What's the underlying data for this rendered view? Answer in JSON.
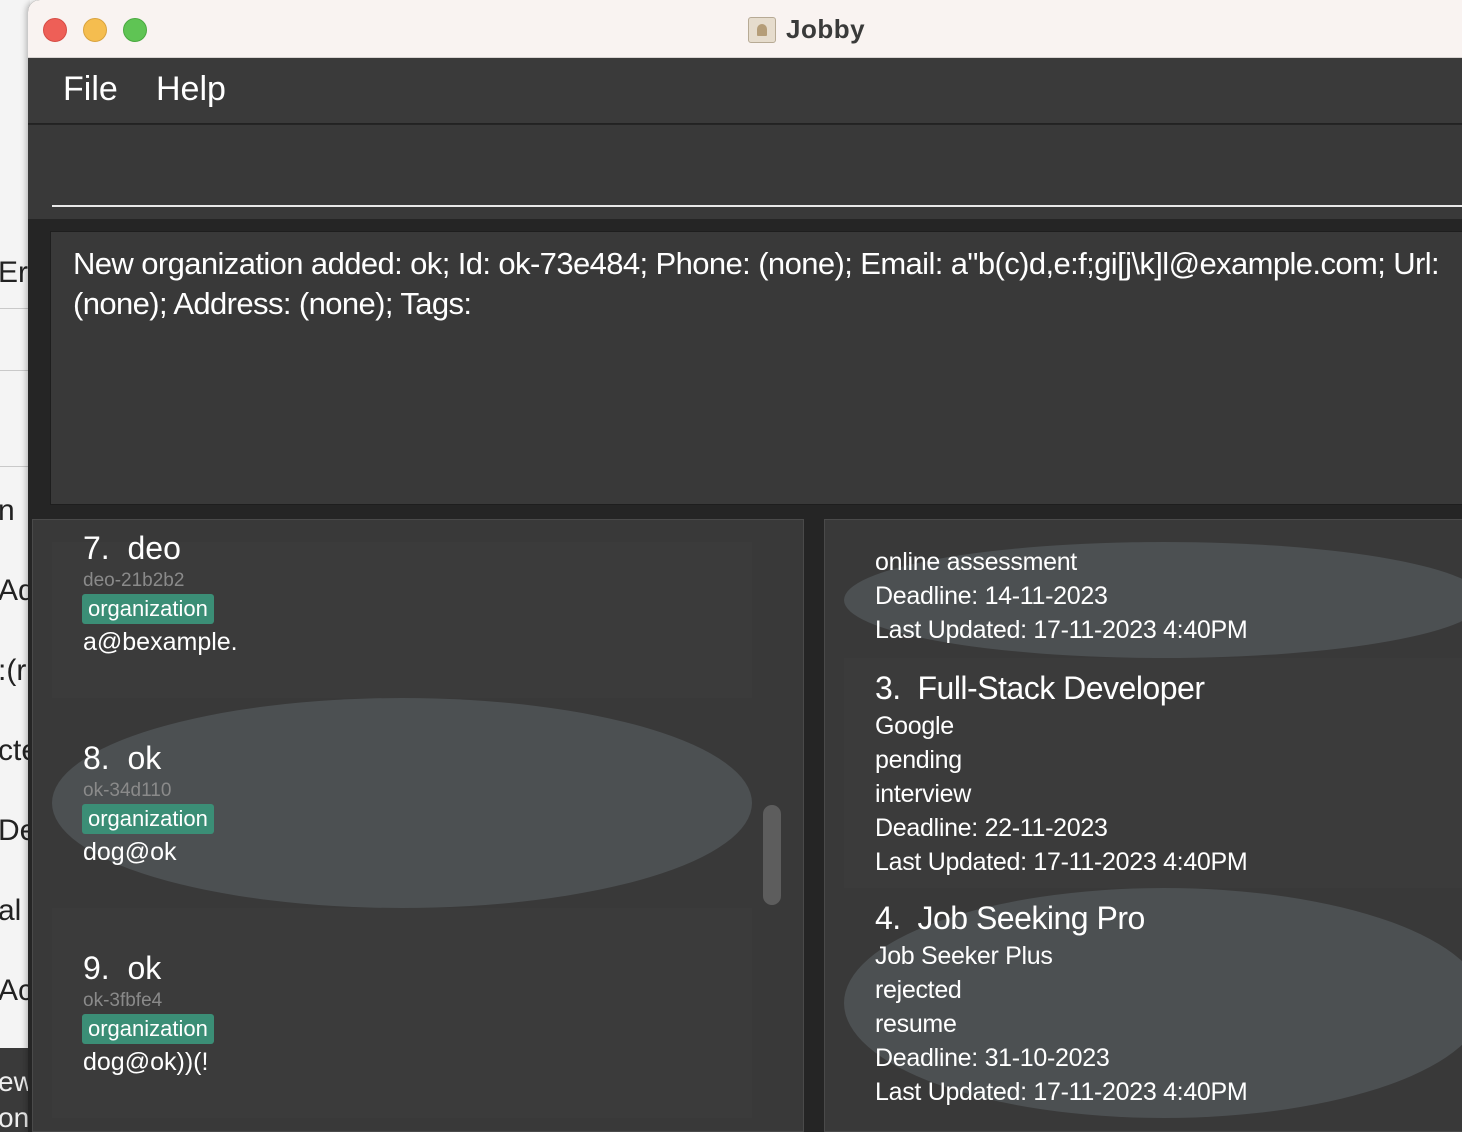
{
  "background_window": {
    "fragments": [
      "Er",
      "n",
      "Ad",
      ":(r",
      "cte",
      "De",
      "al E",
      "Acc",
      "ew",
      "one"
    ]
  },
  "window": {
    "title": "Jobby",
    "menu": [
      "File",
      "Help"
    ]
  },
  "command": {
    "value": ""
  },
  "result": {
    "text": "New organization added: ok; Id: ok-73e484; Phone: (none); Email: a\"b(c)d,e:f;gi[j\\k]l@example.com; Url: (none); Address: (none); Tags:"
  },
  "organizations": [
    {
      "index": "7.",
      "name": "deo",
      "id": "deo-21b2b2",
      "tag": "organization",
      "email": "a@bexample."
    },
    {
      "index": "8.",
      "name": "ok",
      "id": "ok-34d110",
      "tag": "organization",
      "email": "dog@ok"
    },
    {
      "index": "9.",
      "name": "ok",
      "id": "ok-3fbfe4",
      "tag": "organization",
      "email": "dog@ok))(!"
    }
  ],
  "applications": {
    "partial": {
      "stage": "online assessment",
      "deadline": "Deadline: 14-11-2023",
      "updated": "Last Updated: 17-11-2023 4:40PM"
    },
    "items": [
      {
        "index": "3.",
        "title": "Full-Stack Developer",
        "company": "Google",
        "status": "pending",
        "stage": "interview",
        "deadline": "Deadline: 22-11-2023",
        "updated": "Last Updated: 17-11-2023 4:40PM"
      },
      {
        "index": "4.",
        "title": "Job Seeking Pro",
        "company": "Job Seeker Plus",
        "status": "rejected",
        "stage": "resume",
        "deadline": "Deadline: 31-10-2023",
        "updated": "Last Updated: 17-11-2023 4:40PM"
      }
    ]
  },
  "colors": {
    "tag": "#3b8e76",
    "panel": "#393939",
    "selected_card": "#4c5052"
  }
}
